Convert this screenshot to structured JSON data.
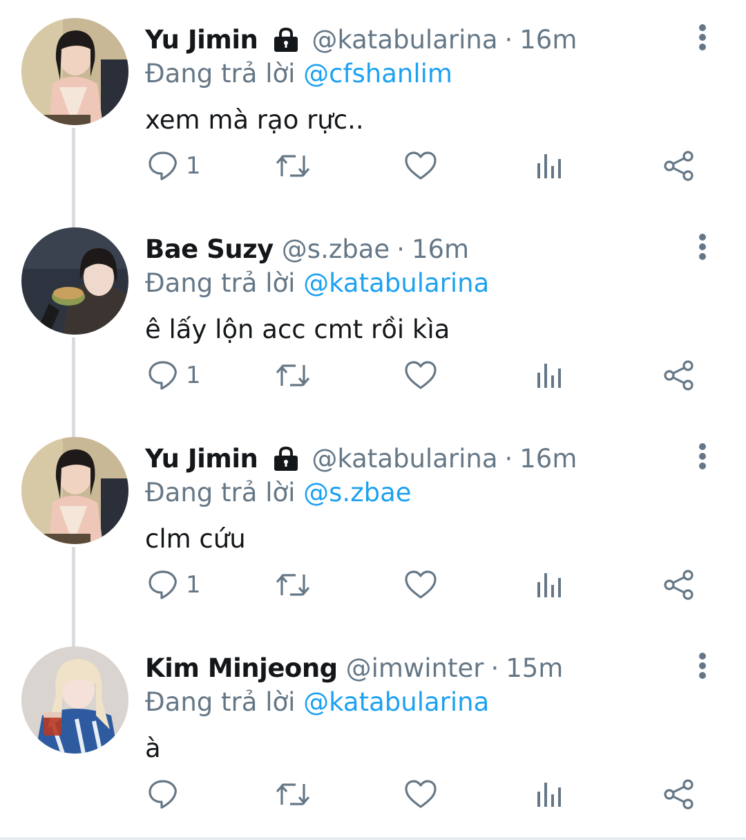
{
  "colors": {
    "link": "#1da1f2",
    "muted": "#657786",
    "icon": "#657786",
    "text": "#14171a",
    "thread_line": "#d9dde1"
  },
  "tweets": [
    {
      "name": "Yu Jimin",
      "protected": true,
      "handle": "@katabularina",
      "separator": "·",
      "time": "16m",
      "reply_prefix": "Đang trả lời ",
      "reply_to": "@cfshanlim",
      "text": "xem mà rạo rực..",
      "reply_count": "1",
      "avatar_icon": "avatar-photo"
    },
    {
      "name": "Bae Suzy",
      "protected": false,
      "handle": "@s.zbae",
      "separator": "·",
      "time": "16m",
      "reply_prefix": "Đang trả lời ",
      "reply_to": "@katabularina",
      "text": "ê lấy lộn acc cmt rồi kìa",
      "reply_count": "1",
      "avatar_icon": "avatar-photo"
    },
    {
      "name": "Yu Jimin",
      "protected": true,
      "handle": "@katabularina",
      "separator": "·",
      "time": "16m",
      "reply_prefix": "Đang trả lời ",
      "reply_to": "@s.zbae",
      "text": "clm cứu",
      "reply_count": "1",
      "avatar_icon": "avatar-photo"
    },
    {
      "name": "Kim Minjeong",
      "protected": false,
      "handle": "@imwinter",
      "separator": "·",
      "time": "15m",
      "reply_prefix": "Đang trả lời ",
      "reply_to": "@katabularina",
      "text": "à",
      "reply_count": "",
      "avatar_icon": "avatar-photo"
    }
  ],
  "icons": {
    "lock": "lock-icon",
    "more": "more-vertical-icon",
    "reply": "reply-icon",
    "retweet": "retweet-icon",
    "like": "heart-icon",
    "analytics": "analytics-icon",
    "share": "share-icon"
  }
}
